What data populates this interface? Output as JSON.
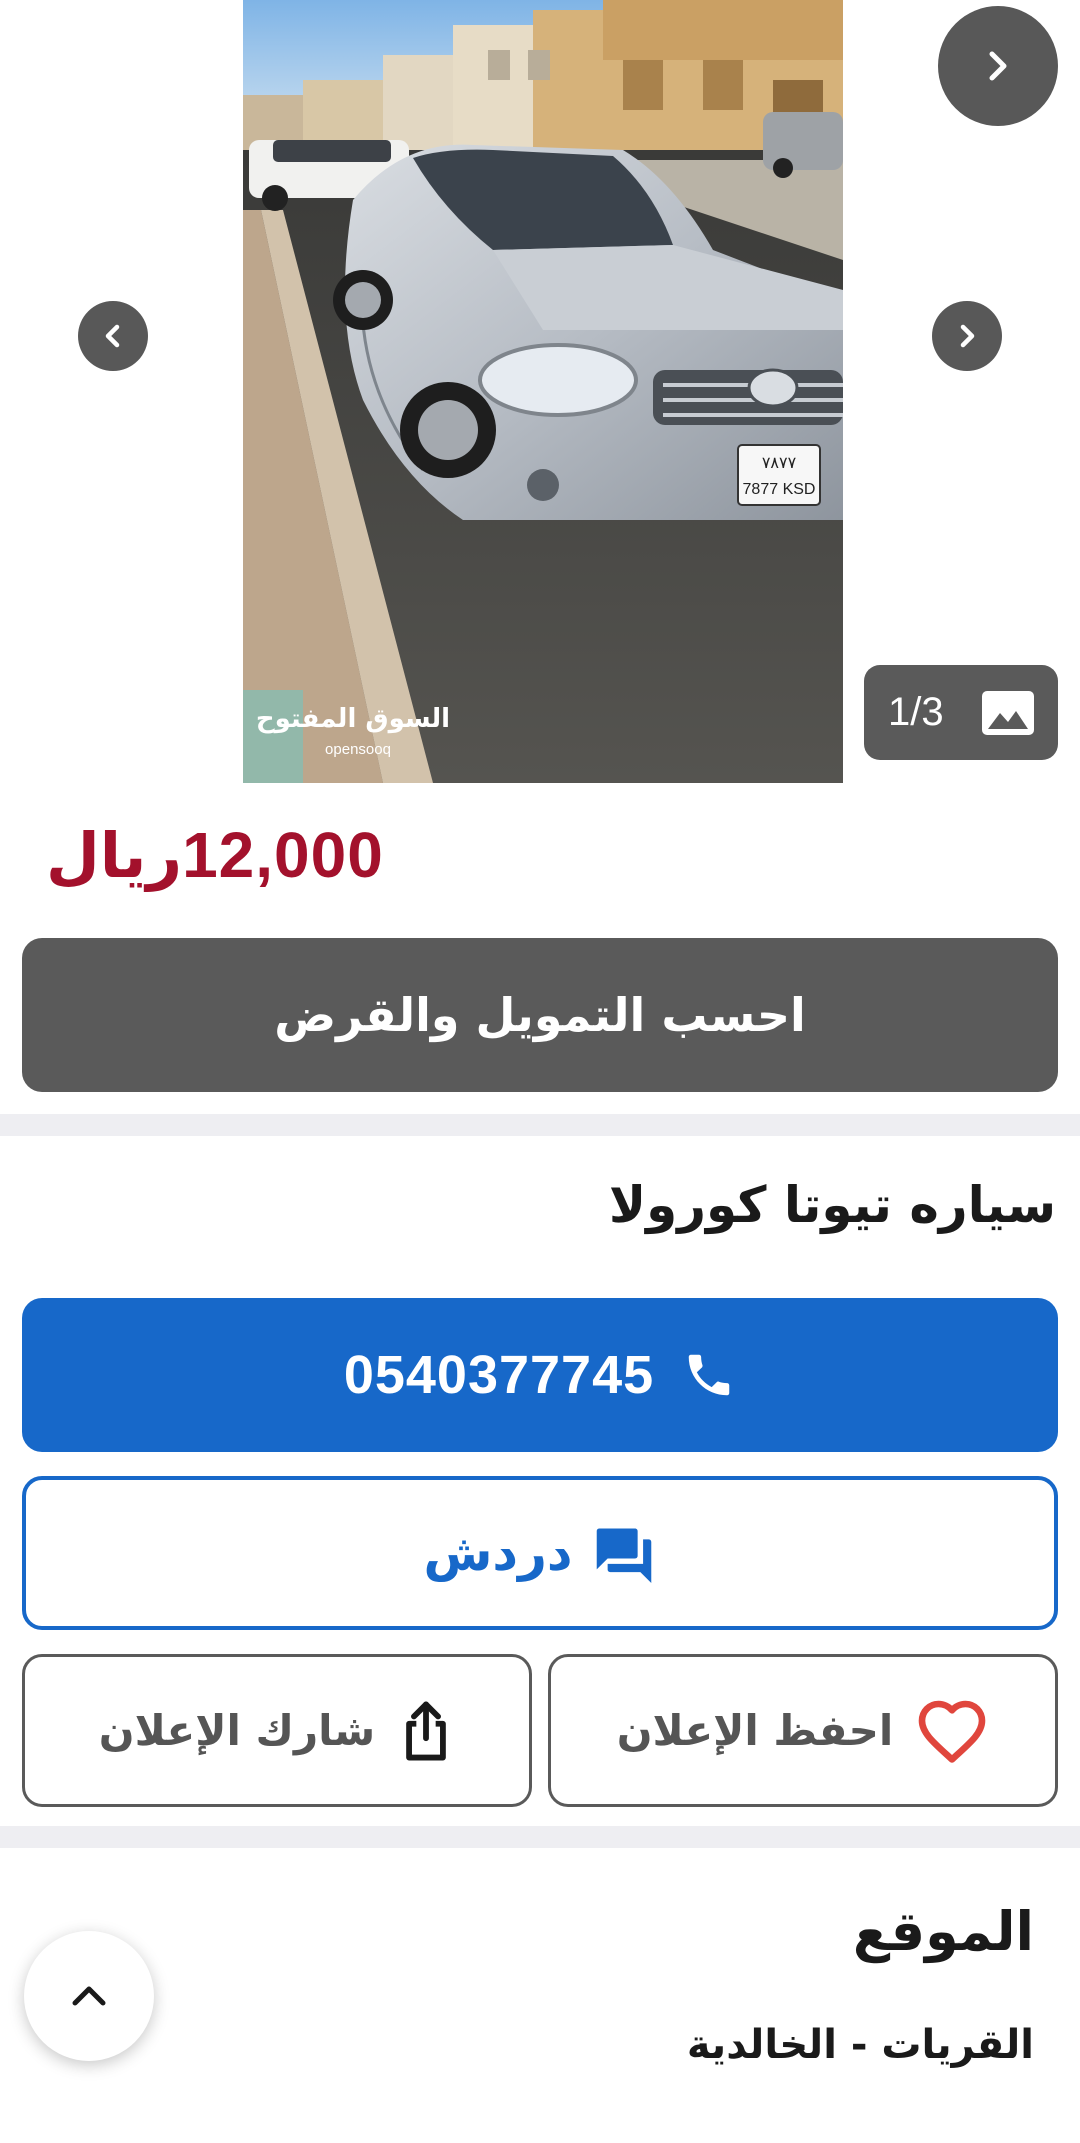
{
  "gallery": {
    "counter": "1/3",
    "watermark_ar": "السوق المفتوح",
    "watermark_en": "opensooq",
    "plate_top": "٧٨٧٧",
    "plate_bottom": "7877 KSD"
  },
  "price": {
    "amount": "12,000",
    "currency": "ريال"
  },
  "finance_button": "احسب التمويل والقرض",
  "ad_title": "سياره تيوتا كورولا",
  "contact": {
    "phone": "0540377745",
    "chat_label": "دردش"
  },
  "actions": {
    "save_label": "احفظ الإعلان",
    "share_label": "شارك الإعلان"
  },
  "location": {
    "heading": "الموقع",
    "value": "القريات - الخالدية"
  },
  "colors": {
    "price": "#a3112c",
    "primary": "#1768c9",
    "dark_button": "#5a5a5a",
    "heart": "#e0463d"
  },
  "icons": {
    "next": "chevron-right-icon",
    "prev": "chevron-left-icon",
    "counter": "image-icon",
    "call": "phone-icon",
    "chat": "chat-bubbles-icon",
    "save": "heart-icon",
    "share": "share-icon",
    "scroll": "chevron-up-icon"
  }
}
